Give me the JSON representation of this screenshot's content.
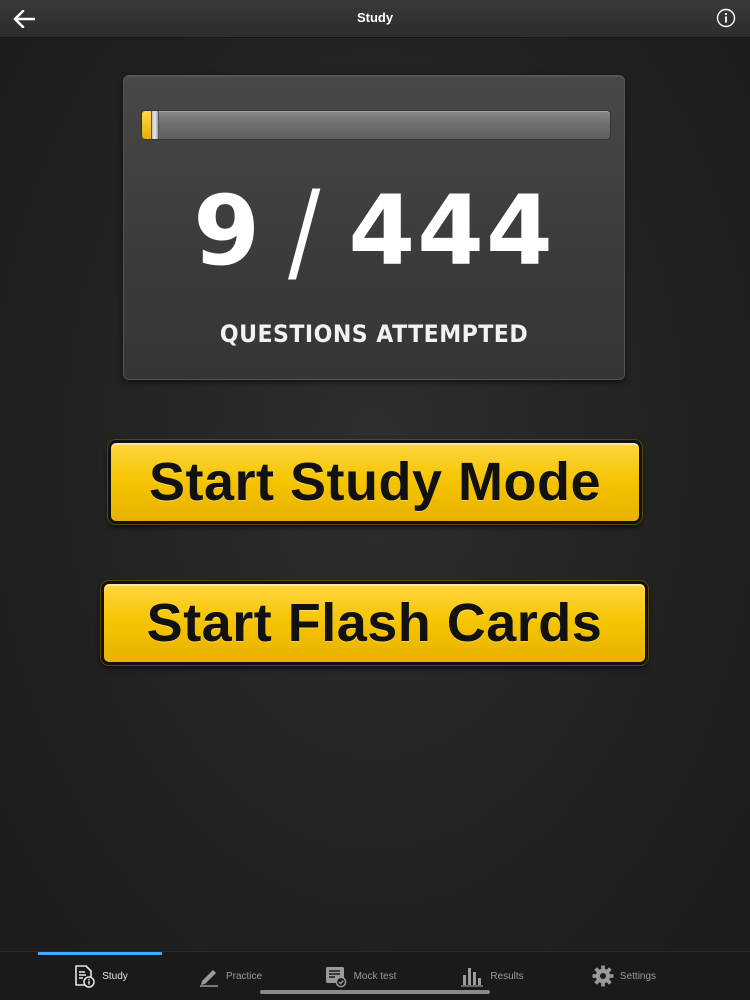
{
  "header": {
    "title": "Study",
    "back_icon": "arrow-left-icon",
    "info_icon": "info-circle-icon"
  },
  "progress": {
    "attempted": "9",
    "separator": "/",
    "total": "444",
    "fraction": 0.0203,
    "caption": "QUESTIONS ATTEMPTED"
  },
  "actions": {
    "study_mode_label": "Start Study Mode",
    "flash_cards_label": "Start Flash Cards"
  },
  "tabs": [
    {
      "label": "Study",
      "icon": "study-doc-icon",
      "active": true
    },
    {
      "label": "Practice",
      "icon": "pencil-icon",
      "active": false
    },
    {
      "label": "Mock test",
      "icon": "mock-test-icon",
      "active": false
    },
    {
      "label": "Results",
      "icon": "bar-chart-icon",
      "active": false
    },
    {
      "label": "Settings",
      "icon": "gear-icon",
      "active": false
    }
  ],
  "colors": {
    "accent_yellow": "#f5c400",
    "tab_active_indicator": "#3fa8ff",
    "background": "#222222"
  }
}
